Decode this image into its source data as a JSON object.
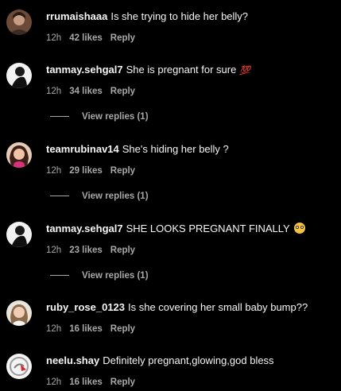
{
  "comments": [
    {
      "user": "rrumaishaaa",
      "text": "Is she trying to hide her belly?",
      "time": "12h",
      "likes": "42 likes",
      "reply": "Reply",
      "emoji": ""
    },
    {
      "user": "tanmay.sehgal7",
      "text": "She is pregnant for sure",
      "time": "12h",
      "likes": "34 likes",
      "reply": "Reply",
      "emoji": "💯",
      "view_replies": "View replies (1)"
    },
    {
      "user": "teamrubinav14",
      "text": "She's hiding her belly ?",
      "time": "12h",
      "likes": "29 likes",
      "reply": "Reply",
      "emoji": "",
      "view_replies": "View replies (1)"
    },
    {
      "user": "tanmay.sehgal7",
      "text": "SHE LOOKS PREGNANT FINALLY",
      "time": "12h",
      "likes": "23 likes",
      "reply": "Reply",
      "emoji": "😳",
      "view_replies": "View replies (1)"
    },
    {
      "user": "ruby_rose_0123",
      "text": "Is she covering her small baby bump??",
      "time": "12h",
      "likes": "16 likes",
      "reply": "Reply",
      "emoji": ""
    },
    {
      "user": "neelu.shay",
      "text": "Definitely pregnant,glowing,god bless",
      "time": "12h",
      "likes": "16 likes",
      "reply": "Reply",
      "emoji": ""
    }
  ],
  "colors": {
    "background": "#000000",
    "primary_text": "#f5f5f5",
    "secondary_text": "#a8a8a8"
  }
}
